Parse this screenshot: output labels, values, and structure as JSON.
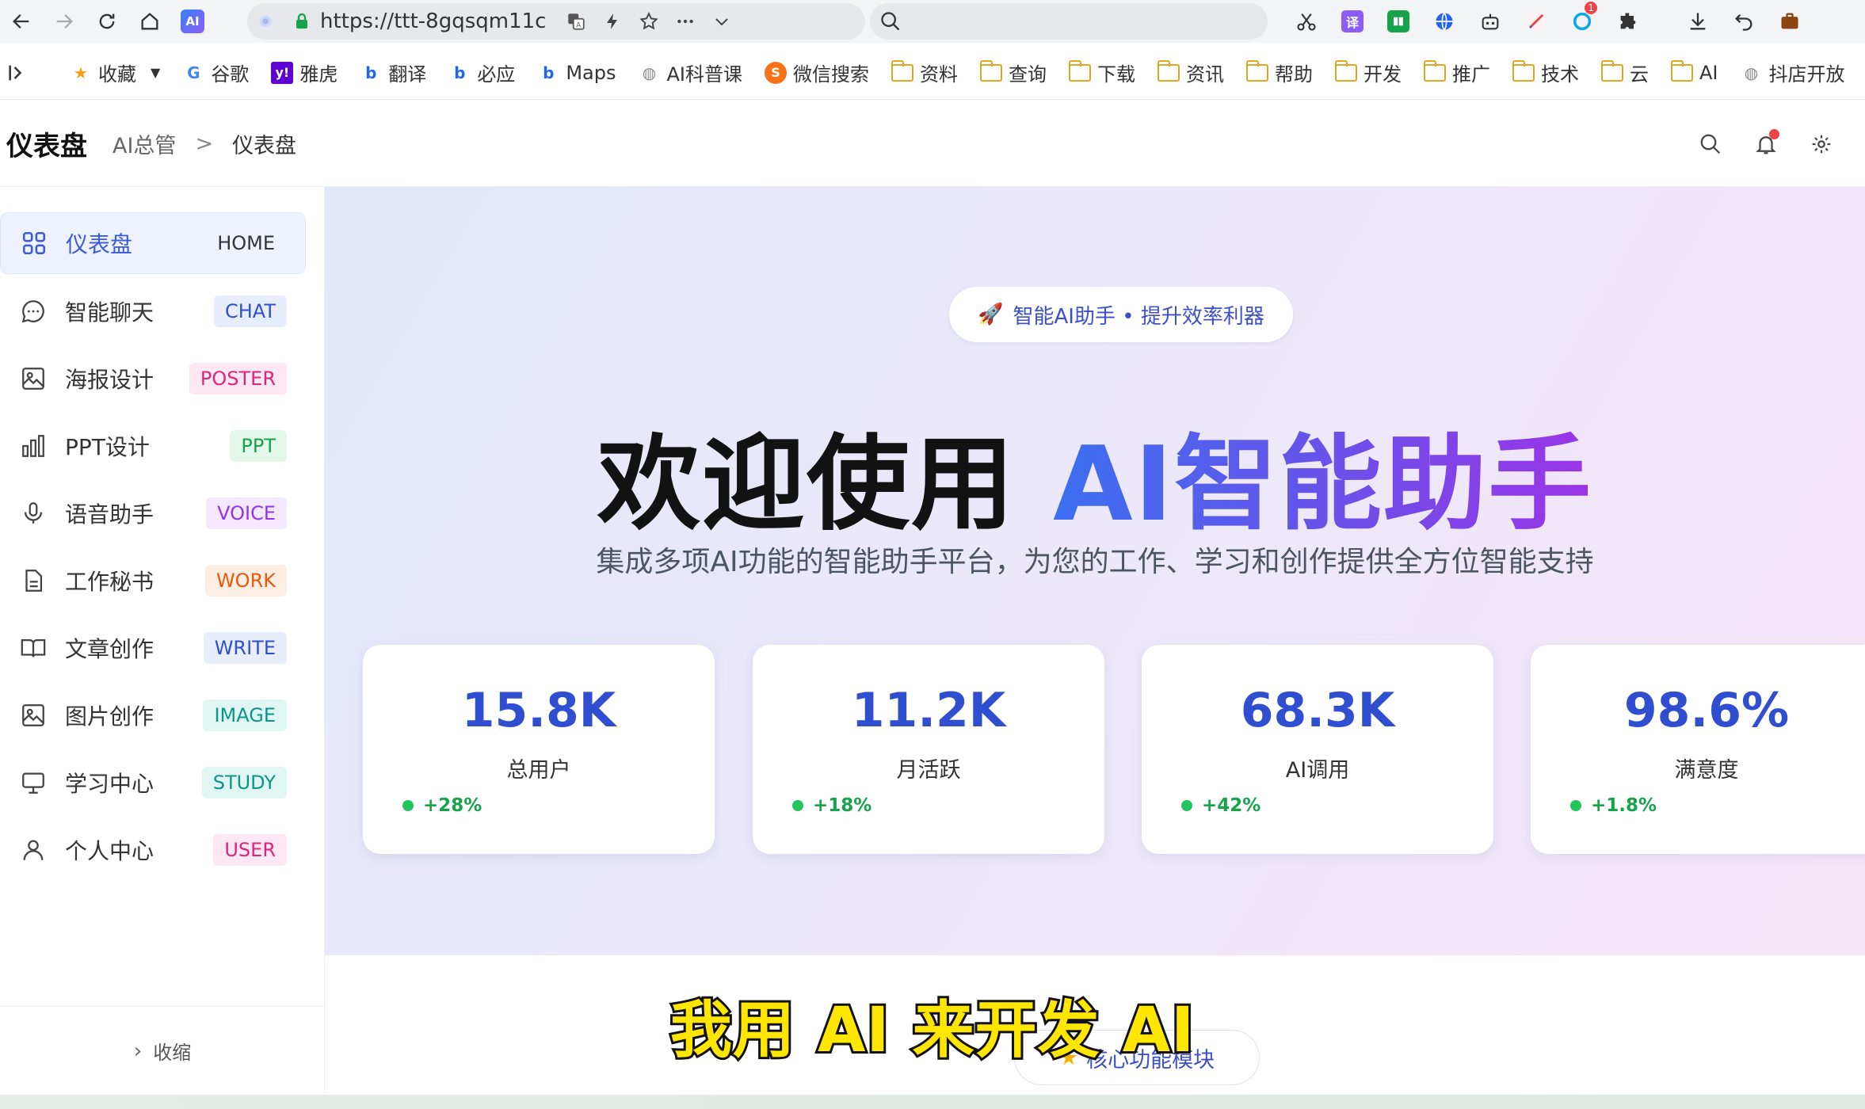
{
  "browser": {
    "url": "https://ttt-8gqsqm11c",
    "ai_badge": "AI",
    "extensions": [
      {
        "name": "scissors-icon",
        "label": "",
        "color": "#333333"
      },
      {
        "name": "translate-icon",
        "label": "译",
        "color": "#8b5cf6"
      },
      {
        "name": "book-icon",
        "label": "",
        "color": "#16a34a"
      },
      {
        "name": "globe-icon",
        "label": "",
        "color": "#2563eb"
      },
      {
        "name": "robot-icon",
        "label": "",
        "color": "#333333"
      },
      {
        "name": "pencil-icon",
        "label": "",
        "color": "#ef4444"
      },
      {
        "name": "sync-icon",
        "label": "",
        "color": "#0ea5e9",
        "badge": "1"
      },
      {
        "name": "puzzle-icon",
        "label": "",
        "color": "#333333"
      }
    ]
  },
  "bookmarks": [
    {
      "label": "收藏",
      "icon": "star-icon"
    },
    {
      "label": "谷歌",
      "icon": "google-icon"
    },
    {
      "label": "雅虎",
      "icon": "yahoo-icon"
    },
    {
      "label": "翻译",
      "icon": "bing-icon"
    },
    {
      "label": "必应",
      "icon": "bing-icon"
    },
    {
      "label": "Maps",
      "icon": "bing-icon"
    },
    {
      "label": "AI科普课",
      "icon": "globe-icon"
    },
    {
      "label": "微信搜索",
      "icon": "sogou-icon"
    },
    {
      "label": "资料",
      "icon": "folder-icon"
    },
    {
      "label": "查询",
      "icon": "folder-icon"
    },
    {
      "label": "下载",
      "icon": "folder-icon"
    },
    {
      "label": "资讯",
      "icon": "folder-icon"
    },
    {
      "label": "帮助",
      "icon": "folder-icon"
    },
    {
      "label": "开发",
      "icon": "folder-icon"
    },
    {
      "label": "推广",
      "icon": "folder-icon"
    },
    {
      "label": "技术",
      "icon": "folder-icon"
    },
    {
      "label": "云",
      "icon": "folder-icon"
    },
    {
      "label": "AI",
      "icon": "folder-icon"
    },
    {
      "label": "抖店开放",
      "icon": "globe-icon"
    }
  ],
  "header": {
    "title": "仪表盘",
    "breadcrumb_root": "AI总管",
    "breadcrumb_sep": ">",
    "breadcrumb_current": "仪表盘"
  },
  "sidebar": {
    "items": [
      {
        "label": "仪表盘",
        "tag": "HOME",
        "icon": "grid-icon",
        "active": true
      },
      {
        "label": "智能聊天",
        "tag": "CHAT",
        "icon": "chat-icon",
        "tag_color": "#2f4fd0",
        "tag_bg": "#e8edfb"
      },
      {
        "label": "海报设计",
        "tag": "POSTER",
        "icon": "image-icon",
        "tag_color": "#db2777",
        "tag_bg": "#fce7f3"
      },
      {
        "label": "PPT设计",
        "tag": "PPT",
        "icon": "bar-chart-icon",
        "tag_color": "#16a34a",
        "tag_bg": "#e3f8ea"
      },
      {
        "label": "语音助手",
        "tag": "VOICE",
        "icon": "mic-icon",
        "tag_color": "#9333ea",
        "tag_bg": "#f3e8fd"
      },
      {
        "label": "工作秘书",
        "tag": "WORK",
        "icon": "document-icon",
        "tag_color": "#ea580c",
        "tag_bg": "#fdeee4"
      },
      {
        "label": "文章创作",
        "tag": "WRITE",
        "icon": "book-open-icon",
        "tag_color": "#2f4fd0",
        "tag_bg": "#e8edfb"
      },
      {
        "label": "图片创作",
        "tag": "IMAGE",
        "icon": "image-icon",
        "tag_color": "#0d9488",
        "tag_bg": "#e0f6f3"
      },
      {
        "label": "学习中心",
        "tag": "STUDY",
        "icon": "monitor-icon",
        "tag_color": "#0d9488",
        "tag_bg": "#e0f6f3"
      },
      {
        "label": "个人中心",
        "tag": "USER",
        "icon": "user-icon",
        "tag_color": "#db2777",
        "tag_bg": "#fce7f3"
      }
    ],
    "collapse_label": "收缩"
  },
  "hero": {
    "pill": "智能AI助手 • 提升效率利器",
    "title_plain": "欢迎使用",
    "title_highlight": "AI智能助手",
    "subtitle": "集成多项AI功能的智能助手平台，为您的工作、学习和创作提供全方位智能支持"
  },
  "stats": [
    {
      "value": "15.8K",
      "label": "总用户",
      "change": "+28%"
    },
    {
      "value": "11.2K",
      "label": "月活跃",
      "change": "+18%"
    },
    {
      "value": "68.3K",
      "label": "AI调用",
      "change": "+42%"
    },
    {
      "value": "98.6%",
      "label": "满意度",
      "change": "+1.8%"
    }
  ],
  "core_pill": "核心功能模块",
  "caption": "我用 AI 来开发 AI",
  "colors": {
    "accent": "#3b5bdb",
    "stat_value": "#2f4fd0",
    "positive": "#16a34a"
  }
}
